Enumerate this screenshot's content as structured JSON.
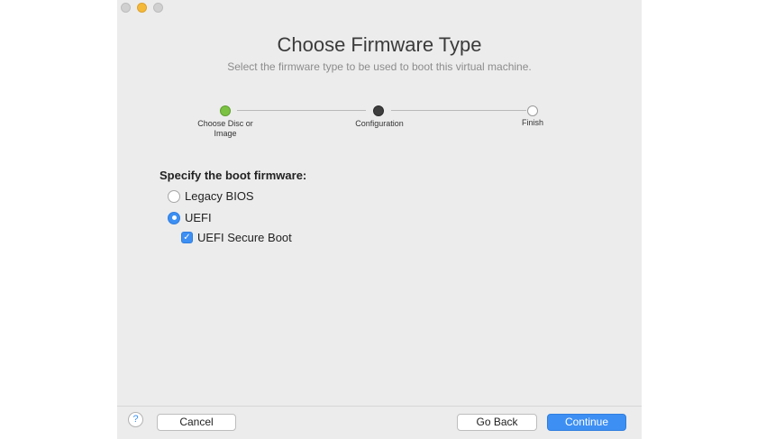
{
  "header": {
    "title": "Choose Firmware Type",
    "subtitle": "Select the firmware type to be used to boot this virtual machine."
  },
  "steps": [
    {
      "label": "Choose Disc or Image",
      "state": "done"
    },
    {
      "label": "Configuration",
      "state": "current"
    },
    {
      "label": "Finish",
      "state": "todo"
    }
  ],
  "form": {
    "section_label": "Specify the boot firmware:",
    "options": [
      {
        "label": "Legacy BIOS",
        "selected": false
      },
      {
        "label": "UEFI",
        "selected": true
      }
    ],
    "secure_boot": {
      "label": "UEFI Secure Boot",
      "checked": true
    }
  },
  "footer": {
    "help_label": "?",
    "cancel_label": "Cancel",
    "back_label": "Go Back",
    "continue_label": "Continue"
  },
  "icons": {
    "check_glyph": "✓"
  },
  "colors": {
    "accent": "#3d8ff3",
    "step_done": "#7cc242",
    "step_current": "#3e3e3e",
    "traffic_minimize": "#f5b93a"
  }
}
